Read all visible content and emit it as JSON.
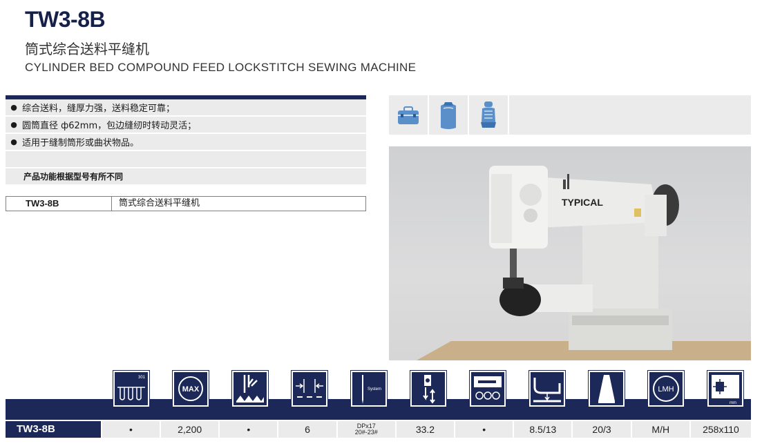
{
  "header": {
    "model": "TW3-8B",
    "name_cn": "筒式综合送料平缝机",
    "name_en": "CYLINDER BED COMPOUND FEED LOCKSTITCH SEWING MACHINE"
  },
  "features": [
    "综合送料，缝厚力强，送料稳定可靠；",
    "圆筒直径 ф62mm，包边缝纫时转动灵活；",
    "适用于缝制筒形或曲状物品。"
  ],
  "note": "产品功能根据型号有所不同",
  "model_table": {
    "model": "TW3-8B",
    "description": "筒式综合送料平缝机"
  },
  "applications": [
    "bag-icon",
    "seat-cushion-icon",
    "car-seat-icon"
  ],
  "photo": {
    "brand": "TYPICAL"
  },
  "spec_icons": {
    "stitch_label": "301",
    "max_label": "MAX",
    "needle_label": "System",
    "lmh_label": "LMH",
    "table_label": "mm"
  },
  "spec_row": {
    "model": "TW3-8B",
    "values": [
      "•",
      "2,200",
      "•",
      "6",
      "",
      "33.2",
      "•",
      "8.5/13",
      "20/3",
      "M/H",
      "258x110"
    ],
    "needle_line1": "DPx17",
    "needle_line2": "20#-23#"
  },
  "colors": {
    "navy": "#1c2858",
    "light_gray": "#ebebeb"
  }
}
